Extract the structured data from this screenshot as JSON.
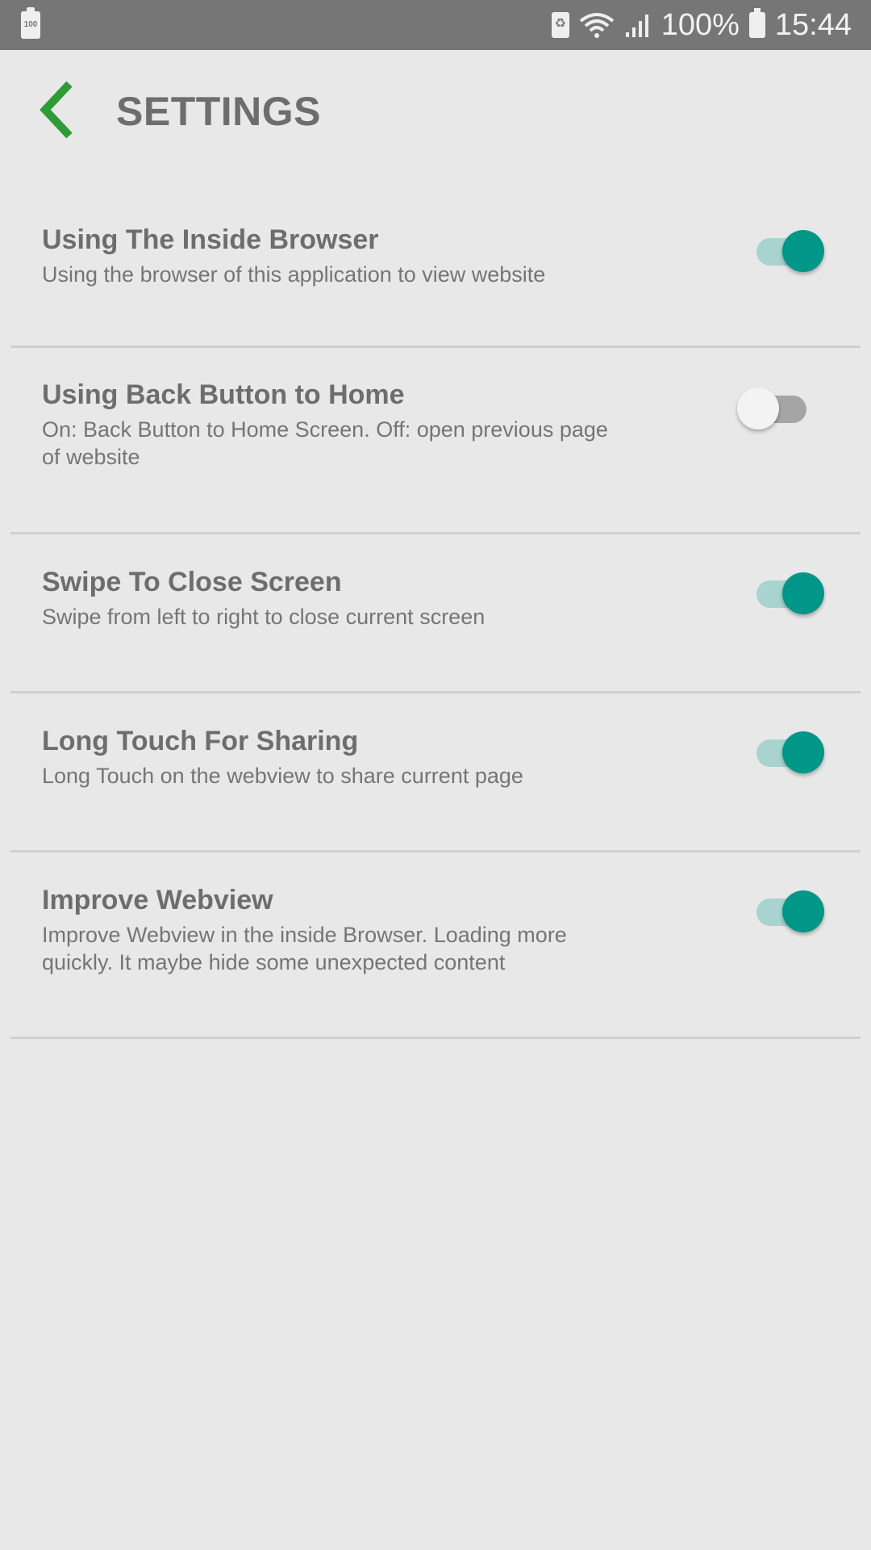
{
  "status_bar": {
    "left_icon_text": "100",
    "left_icon": "battery-saver-icon",
    "recycle_icon": "recycle-icon",
    "wifi_icon": "wifi-icon",
    "signal_icon": "signal-icon",
    "battery_percent": "100%",
    "battery_icon": "battery-icon",
    "time": "15:44"
  },
  "header": {
    "back_icon": "chevron-left-icon",
    "title": "SETTINGS",
    "accent_color": "#2e9b37"
  },
  "settings": [
    {
      "title": "Using The Inside Browser",
      "description": "Using the browser of this application to view website",
      "enabled": true
    },
    {
      "title": "Using Back Button to Home",
      "description": "On: Back Button to Home Screen. Off: open previous page of website",
      "enabled": false
    },
    {
      "title": "Swipe To Close Screen",
      "description": "Swipe from left to right to close current screen",
      "enabled": true
    },
    {
      "title": "Long Touch For Sharing",
      "description": "Long Touch on the webview to share current page",
      "enabled": true
    },
    {
      "title": "Improve Webview",
      "description": "Improve Webview in the inside Browser. Loading more quickly. It maybe hide some unexpected content",
      "enabled": true
    }
  ],
  "colors": {
    "background": "#e8e8e8",
    "status_bar": "#767676",
    "toggle_on_thumb": "#009688",
    "toggle_on_track": "#a9d3cf",
    "toggle_off_thumb": "#f3f3f3",
    "toggle_off_track": "#a5a5a5",
    "text_primary": "#6d6d6d",
    "text_secondary": "#757575"
  }
}
